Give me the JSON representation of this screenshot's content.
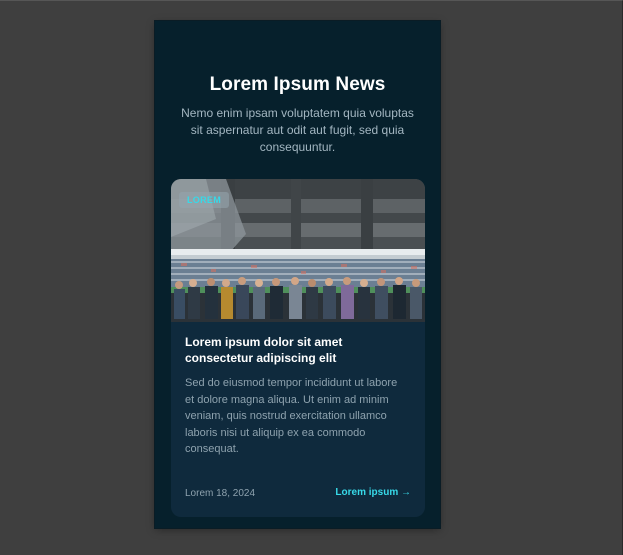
{
  "page": {
    "heading": "Lorem Ipsum News",
    "subheading": "Nemo enim ipsam voluptatem quia voluptas sit aspernatur aut odit aut fugit, sed quia consequuntur."
  },
  "card": {
    "category": "LOREM",
    "image_description": "stadium crowd photo",
    "title": "Lorem ipsum dolor sit amet consectetur adipiscing elit",
    "body": "Sed do eiusmod tempor incididunt ut labore et dolore magna aliqua. Ut enim ad minim veniam, quis nostrud exercitation ullamco laboris nisi ut aliquip ex ea commodo consequat.",
    "date": "Lorem 18, 2024",
    "link_label": "Lorem ipsum →"
  },
  "colors": {
    "background": "#3f3f3f",
    "phone_background": "#06202c",
    "card_background": "#0f2a3d",
    "accent": "#37d9e8",
    "muted_text": "#8ea2ae"
  }
}
